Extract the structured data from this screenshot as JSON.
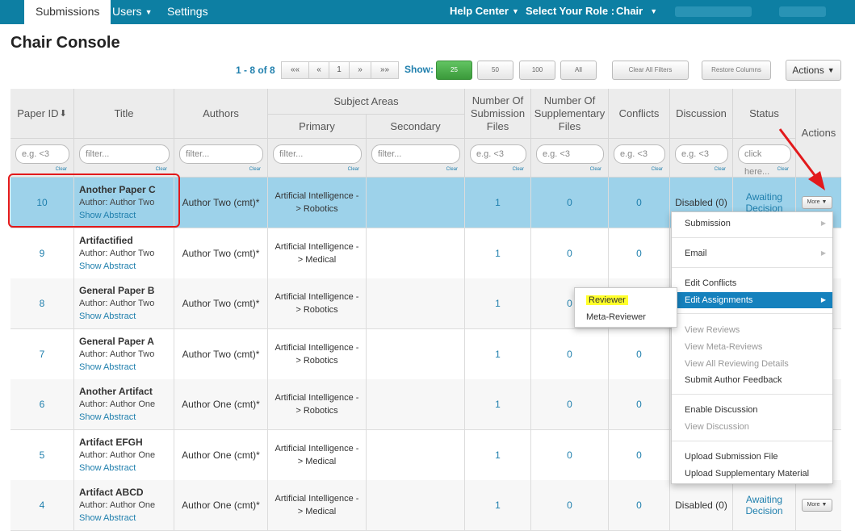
{
  "nav": {
    "tabs": [
      {
        "label": "Submissions"
      },
      {
        "label": "Users"
      },
      {
        "label": "Settings"
      }
    ],
    "help_center": "Help Center",
    "role_label": "Select Your Role :",
    "role_value": "Chair"
  },
  "page_title": "Chair Console",
  "pager": {
    "info": "1 - 8 of 8",
    "first": "««",
    "prev": "«",
    "page": "1",
    "next": "»",
    "last": "»»",
    "show_label": "Show:",
    "sizes": [
      "25",
      "50",
      "100",
      "All"
    ],
    "clear_filters": "Clear All Filters",
    "restore_columns": "Restore Columns",
    "actions": "Actions"
  },
  "columns": {
    "paper_id": "Paper ID",
    "title": "Title",
    "authors": "Authors",
    "subject_areas": "Subject Areas",
    "primary": "Primary",
    "secondary": "Secondary",
    "num_sub_files": "Number Of Submission Files",
    "num_supp_files": "Number Of Supplementary Files",
    "conflicts": "Conflicts",
    "discussion": "Discussion",
    "status": "Status",
    "actions": "Actions"
  },
  "filters": {
    "paper_id": "e.g. <3",
    "title": "filter...",
    "authors": "filter...",
    "primary": "filter...",
    "secondary": "filter...",
    "num_sub_files": "e.g. <3",
    "num_supp_files": "e.g. <3",
    "conflicts": "e.g. <3",
    "discussion": "e.g. <3",
    "status": "click here...",
    "clear": "Clear"
  },
  "rows": [
    {
      "id": "10",
      "title": "Another Paper C",
      "author_line": "Author: Author Two",
      "abstract": "Show Abstract",
      "authors": "Author Two (cmt)*",
      "primary": "Artificial Intelligence -> Robotics",
      "sub": "1",
      "supp": "0",
      "conflicts": "0",
      "discussion": "Disabled (0)",
      "status": "Awaiting Decision",
      "more": "More"
    },
    {
      "id": "9",
      "title": "Artifactified",
      "author_line": "Author: Author Two",
      "abstract": "Show Abstract",
      "authors": "Author Two (cmt)*",
      "primary": "Artificial Intelligence -> Medical",
      "sub": "1",
      "supp": "0",
      "conflicts": "0",
      "discussion": "",
      "status": "",
      "more": ""
    },
    {
      "id": "8",
      "title": "General Paper B",
      "author_line": "Author: Author Two",
      "abstract": "Show Abstract",
      "authors": "Author Two (cmt)*",
      "primary": "Artificial Intelligence -> Robotics",
      "sub": "1",
      "supp": "0",
      "conflicts": "",
      "discussion": "",
      "status": "",
      "more": ""
    },
    {
      "id": "7",
      "title": "General Paper A",
      "author_line": "Author: Author Two",
      "abstract": "Show Abstract",
      "authors": "Author Two (cmt)*",
      "primary": "Artificial Intelligence -> Robotics",
      "sub": "1",
      "supp": "0",
      "conflicts": "0",
      "discussion": "",
      "status": "",
      "more": ""
    },
    {
      "id": "6",
      "title": "Another Artifact",
      "author_line": "Author: Author One",
      "abstract": "Show Abstract",
      "authors": "Author One (cmt)*",
      "primary": "Artificial Intelligence -> Robotics",
      "sub": "1",
      "supp": "0",
      "conflicts": "0",
      "discussion": "",
      "status": "",
      "more": ""
    },
    {
      "id": "5",
      "title": "Artifact EFGH",
      "author_line": "Author: Author One",
      "abstract": "Show Abstract",
      "authors": "Author One (cmt)*",
      "primary": "Artificial Intelligence -> Medical",
      "sub": "1",
      "supp": "0",
      "conflicts": "0",
      "discussion": "",
      "status": "",
      "more": ""
    },
    {
      "id": "4",
      "title": "Artifact ABCD",
      "author_line": "Author: Author One",
      "abstract": "Show Abstract",
      "authors": "Author One (cmt)*",
      "primary": "Artificial Intelligence -> Medical",
      "sub": "1",
      "supp": "0",
      "conflicts": "0",
      "discussion": "Disabled (0)",
      "status": "Awaiting Decision",
      "more": "More"
    }
  ],
  "menu": {
    "submission": "Submission",
    "email": "Email",
    "edit_conflicts": "Edit Conflicts",
    "edit_assignments": "Edit Assignments",
    "view_reviews": "View Reviews",
    "view_meta_reviews": "View Meta-Reviews",
    "view_all_reviewing": "View All Reviewing Details",
    "submit_author_feedback": "Submit Author Feedback",
    "enable_discussion": "Enable Discussion",
    "view_discussion": "View Discussion",
    "upload_submission_file": "Upload Submission File",
    "upload_supplementary": "Upload Supplementary Material"
  },
  "submenu": {
    "reviewer": "Reviewer",
    "meta_reviewer": "Meta-Reviewer"
  },
  "colors": {
    "nav_bg": "#0d7fa3",
    "link": "#1f7fad",
    "selected_row": "#9dd2ea",
    "menu_highlight": "#1581bd",
    "annotation_red": "#e2191b",
    "highlight_yellow": "#ffff2a"
  }
}
